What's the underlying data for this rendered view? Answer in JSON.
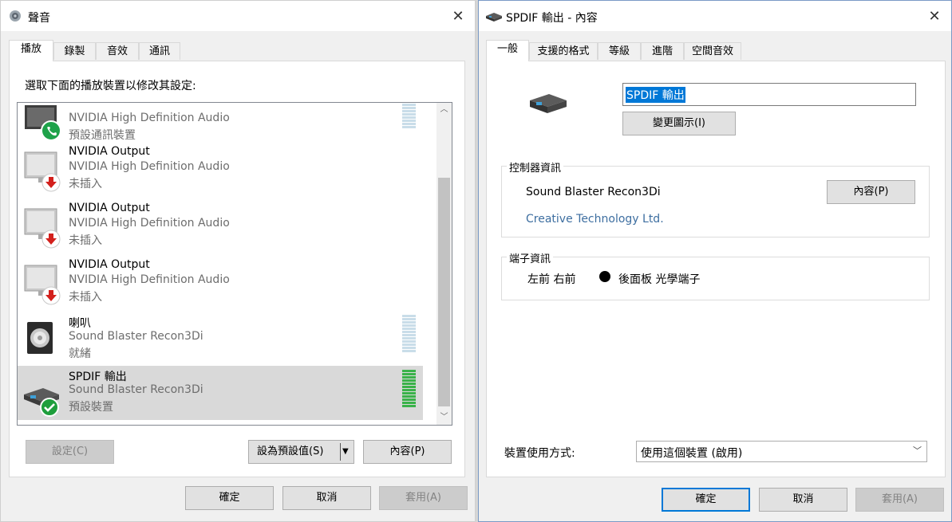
{
  "sound_window": {
    "title": "聲音",
    "tabs": [
      {
        "label": "播放"
      },
      {
        "label": "錄製"
      },
      {
        "label": "音效"
      },
      {
        "label": "通訊"
      }
    ],
    "instruction": "選取下面的播放裝置以修改其設定:",
    "devices": [
      {
        "name": "",
        "driver": "NVIDIA High Definition Audio",
        "status": "預設通訊裝置"
      },
      {
        "name": "NVIDIA Output",
        "driver": "NVIDIA High Definition Audio",
        "status": "未插入"
      },
      {
        "name": "NVIDIA Output",
        "driver": "NVIDIA High Definition Audio",
        "status": "未插入"
      },
      {
        "name": "NVIDIA Output",
        "driver": "NVIDIA High Definition Audio",
        "status": "未插入"
      },
      {
        "name": "喇叭",
        "driver": "Sound Blaster Recon3Di",
        "status": "就緒"
      },
      {
        "name": "SPDIF 輸出",
        "driver": "Sound Blaster Recon3Di",
        "status": "預設裝置"
      }
    ],
    "buttons": {
      "configure": "設定(C)",
      "set_default": "設為預設值(S)",
      "properties": "內容(P)",
      "ok": "確定",
      "cancel": "取消",
      "apply": "套用(A)"
    }
  },
  "props_window": {
    "title": "SPDIF 輸出 - 內容",
    "tabs": [
      {
        "label": "一般"
      },
      {
        "label": "支援的格式"
      },
      {
        "label": "等級"
      },
      {
        "label": "進階"
      },
      {
        "label": "空間音效"
      }
    ],
    "device_name_value": "SPDIF 輸出",
    "change_icon_button": "變更圖示(I)",
    "controller_group": {
      "title": "控制器資訊",
      "name": "Sound Blaster Recon3Di",
      "vendor": "Creative Technology Ltd.",
      "properties_button": "內容(P)"
    },
    "jack_group": {
      "title": "端子資訊",
      "channels": "左前 右前",
      "jack": "後面板 光學端子"
    },
    "usage_label": "裝置使用方式:",
    "usage_value": "使用這個裝置 (啟用)",
    "buttons": {
      "ok": "確定",
      "cancel": "取消",
      "apply": "套用(A)"
    }
  },
  "colors": {
    "accent": "#0078d7",
    "link": "#3d6ea0",
    "selected_row": "#d9d9d9",
    "meter_active": "#3ab24a",
    "meter_idle": "#c9dde9"
  }
}
